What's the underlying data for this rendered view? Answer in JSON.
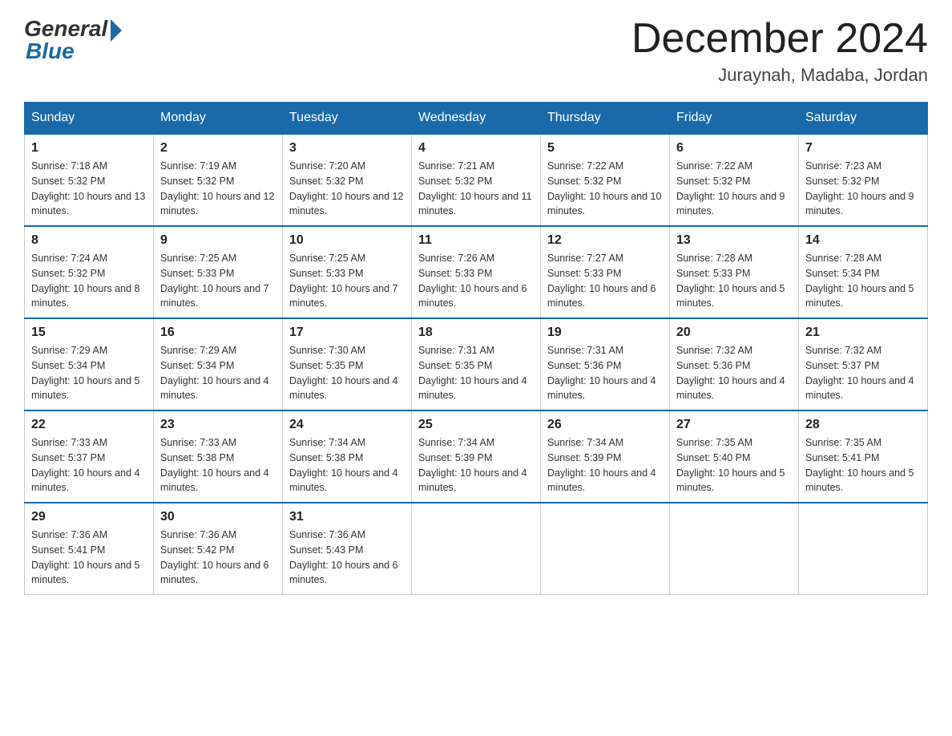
{
  "header": {
    "logo_general": "General",
    "logo_blue": "Blue",
    "month_title": "December 2024",
    "location": "Juraynah, Madaba, Jordan"
  },
  "days_of_week": [
    "Sunday",
    "Monday",
    "Tuesday",
    "Wednesday",
    "Thursday",
    "Friday",
    "Saturday"
  ],
  "weeks": [
    [
      {
        "day": "1",
        "sunrise": "7:18 AM",
        "sunset": "5:32 PM",
        "daylight": "10 hours and 13 minutes."
      },
      {
        "day": "2",
        "sunrise": "7:19 AM",
        "sunset": "5:32 PM",
        "daylight": "10 hours and 12 minutes."
      },
      {
        "day": "3",
        "sunrise": "7:20 AM",
        "sunset": "5:32 PM",
        "daylight": "10 hours and 12 minutes."
      },
      {
        "day": "4",
        "sunrise": "7:21 AM",
        "sunset": "5:32 PM",
        "daylight": "10 hours and 11 minutes."
      },
      {
        "day": "5",
        "sunrise": "7:22 AM",
        "sunset": "5:32 PM",
        "daylight": "10 hours and 10 minutes."
      },
      {
        "day": "6",
        "sunrise": "7:22 AM",
        "sunset": "5:32 PM",
        "daylight": "10 hours and 9 minutes."
      },
      {
        "day": "7",
        "sunrise": "7:23 AM",
        "sunset": "5:32 PM",
        "daylight": "10 hours and 9 minutes."
      }
    ],
    [
      {
        "day": "8",
        "sunrise": "7:24 AM",
        "sunset": "5:32 PM",
        "daylight": "10 hours and 8 minutes."
      },
      {
        "day": "9",
        "sunrise": "7:25 AM",
        "sunset": "5:33 PM",
        "daylight": "10 hours and 7 minutes."
      },
      {
        "day": "10",
        "sunrise": "7:25 AM",
        "sunset": "5:33 PM",
        "daylight": "10 hours and 7 minutes."
      },
      {
        "day": "11",
        "sunrise": "7:26 AM",
        "sunset": "5:33 PM",
        "daylight": "10 hours and 6 minutes."
      },
      {
        "day": "12",
        "sunrise": "7:27 AM",
        "sunset": "5:33 PM",
        "daylight": "10 hours and 6 minutes."
      },
      {
        "day": "13",
        "sunrise": "7:28 AM",
        "sunset": "5:33 PM",
        "daylight": "10 hours and 5 minutes."
      },
      {
        "day": "14",
        "sunrise": "7:28 AM",
        "sunset": "5:34 PM",
        "daylight": "10 hours and 5 minutes."
      }
    ],
    [
      {
        "day": "15",
        "sunrise": "7:29 AM",
        "sunset": "5:34 PM",
        "daylight": "10 hours and 5 minutes."
      },
      {
        "day": "16",
        "sunrise": "7:29 AM",
        "sunset": "5:34 PM",
        "daylight": "10 hours and 4 minutes."
      },
      {
        "day": "17",
        "sunrise": "7:30 AM",
        "sunset": "5:35 PM",
        "daylight": "10 hours and 4 minutes."
      },
      {
        "day": "18",
        "sunrise": "7:31 AM",
        "sunset": "5:35 PM",
        "daylight": "10 hours and 4 minutes."
      },
      {
        "day": "19",
        "sunrise": "7:31 AM",
        "sunset": "5:36 PM",
        "daylight": "10 hours and 4 minutes."
      },
      {
        "day": "20",
        "sunrise": "7:32 AM",
        "sunset": "5:36 PM",
        "daylight": "10 hours and 4 minutes."
      },
      {
        "day": "21",
        "sunrise": "7:32 AM",
        "sunset": "5:37 PM",
        "daylight": "10 hours and 4 minutes."
      }
    ],
    [
      {
        "day": "22",
        "sunrise": "7:33 AM",
        "sunset": "5:37 PM",
        "daylight": "10 hours and 4 minutes."
      },
      {
        "day": "23",
        "sunrise": "7:33 AM",
        "sunset": "5:38 PM",
        "daylight": "10 hours and 4 minutes."
      },
      {
        "day": "24",
        "sunrise": "7:34 AM",
        "sunset": "5:38 PM",
        "daylight": "10 hours and 4 minutes."
      },
      {
        "day": "25",
        "sunrise": "7:34 AM",
        "sunset": "5:39 PM",
        "daylight": "10 hours and 4 minutes."
      },
      {
        "day": "26",
        "sunrise": "7:34 AM",
        "sunset": "5:39 PM",
        "daylight": "10 hours and 4 minutes."
      },
      {
        "day": "27",
        "sunrise": "7:35 AM",
        "sunset": "5:40 PM",
        "daylight": "10 hours and 5 minutes."
      },
      {
        "day": "28",
        "sunrise": "7:35 AM",
        "sunset": "5:41 PM",
        "daylight": "10 hours and 5 minutes."
      }
    ],
    [
      {
        "day": "29",
        "sunrise": "7:36 AM",
        "sunset": "5:41 PM",
        "daylight": "10 hours and 5 minutes."
      },
      {
        "day": "30",
        "sunrise": "7:36 AM",
        "sunset": "5:42 PM",
        "daylight": "10 hours and 6 minutes."
      },
      {
        "day": "31",
        "sunrise": "7:36 AM",
        "sunset": "5:43 PM",
        "daylight": "10 hours and 6 minutes."
      },
      null,
      null,
      null,
      null
    ]
  ],
  "labels": {
    "sunrise": "Sunrise:",
    "sunset": "Sunset:",
    "daylight": "Daylight:"
  }
}
